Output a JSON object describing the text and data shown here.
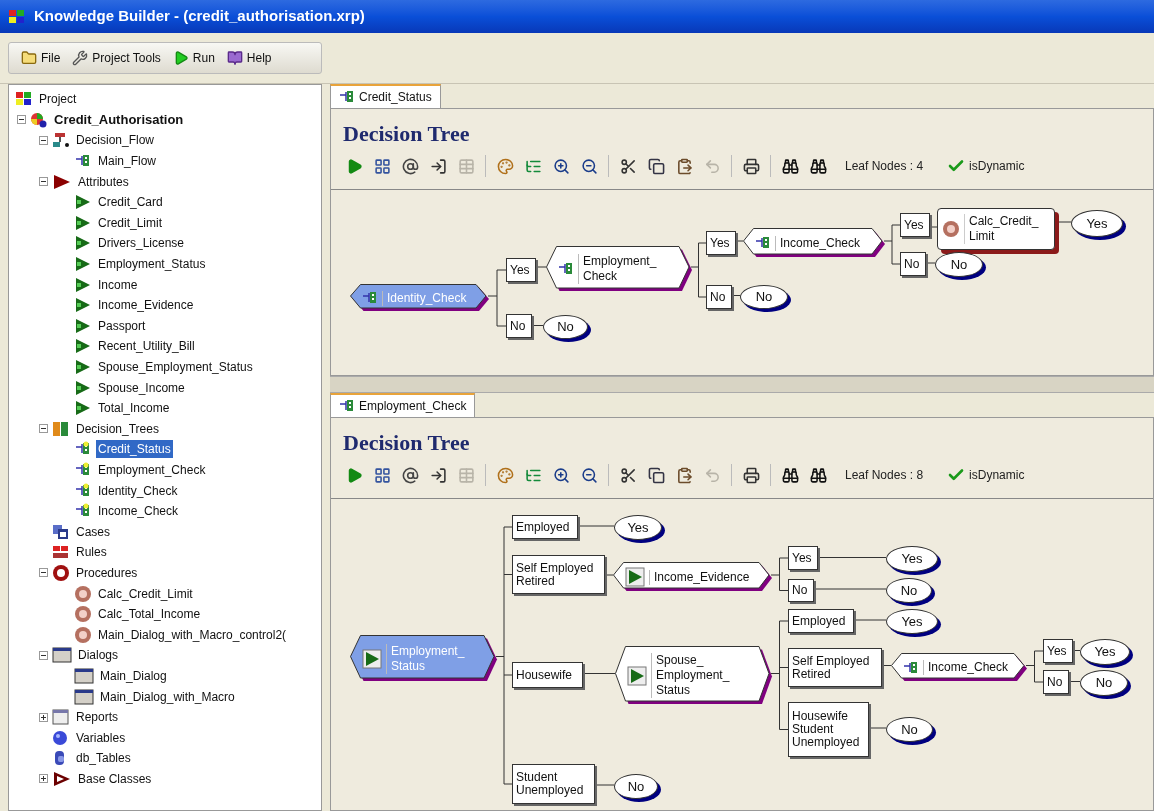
{
  "window": {
    "title": "Knowledge Builder - (credit_authorisation.xrp)"
  },
  "menu": [
    {
      "kind": "file",
      "label": "File"
    },
    {
      "kind": "tools",
      "label": "Project Tools"
    },
    {
      "kind": "run",
      "label": "Run"
    },
    {
      "kind": "help",
      "label": "Help"
    }
  ],
  "project_tree": {
    "label": "Project",
    "kind": "project",
    "children": [
      {
        "label": "Credit_Authorisation",
        "kind": "app",
        "expanded": true,
        "children": [
          {
            "label": "Decision_Flow",
            "kind": "flow",
            "expanded": true,
            "children": [
              {
                "label": "Main_Flow",
                "kind": "flow_item",
                "selected": false
              }
            ]
          },
          {
            "label": "Attributes",
            "kind": "attr_folder",
            "expanded": true,
            "children": [
              {
                "label": "Credit_Card",
                "kind": "attribute",
                "selected": false
              },
              {
                "label": "Credit_Limit",
                "kind": "attribute",
                "selected": false
              },
              {
                "label": "Drivers_License",
                "kind": "attribute",
                "selected": false
              },
              {
                "label": "Employment_Status",
                "kind": "attribute",
                "selected": false
              },
              {
                "label": "Income",
                "kind": "attribute",
                "selected": false
              },
              {
                "label": "Income_Evidence",
                "kind": "attribute",
                "selected": false
              },
              {
                "label": "Passport",
                "kind": "attribute",
                "selected": false
              },
              {
                "label": "Recent_Utility_Bill",
                "kind": "attribute",
                "selected": false
              },
              {
                "label": "Spouse_Employment_Status",
                "kind": "attribute",
                "selected": false
              },
              {
                "label": "Spouse_Income",
                "kind": "attribute",
                "selected": false
              },
              {
                "label": "Total_Income",
                "kind": "attribute",
                "selected": false
              }
            ]
          },
          {
            "label": "Decision_Trees",
            "kind": "tree_folder",
            "expanded": true,
            "children": [
              {
                "label": "Credit_Status",
                "kind": "tree",
                "selected": true
              },
              {
                "label": "Employment_Check",
                "kind": "tree",
                "selected": false
              },
              {
                "label": "Identity_Check",
                "kind": "tree",
                "selected": false
              },
              {
                "label": "Income_Check",
                "kind": "tree",
                "selected": false
              }
            ]
          },
          {
            "label": "Cases",
            "kind": "cases"
          },
          {
            "label": "Rules",
            "kind": "rules"
          },
          {
            "label": "Procedures",
            "kind": "proc_folder",
            "expanded": true,
            "children": [
              {
                "label": "Calc_Credit_Limit",
                "kind": "procedure",
                "selected": false
              },
              {
                "label": "Calc_Total_Income",
                "kind": "procedure",
                "selected": false
              },
              {
                "label": "Main_Dialog_with_Macro_control2(",
                "kind": "procedure",
                "selected": false
              }
            ]
          },
          {
            "label": "Dialogs",
            "kind": "dialog_folder",
            "expanded": true,
            "children": [
              {
                "label": "Main_Dialog",
                "kind": "dialog",
                "selected": false
              },
              {
                "label": "Main_Dialog_with_Macro",
                "kind": "dialog",
                "selected": false
              }
            ]
          },
          {
            "label": "Reports",
            "kind": "reports",
            "expanded": false
          },
          {
            "label": "Variables",
            "kind": "variables"
          },
          {
            "label": "db_Tables",
            "kind": "tables"
          },
          {
            "label": "Base Classes",
            "kind": "classes",
            "expanded": false
          }
        ]
      }
    ]
  },
  "panes": [
    {
      "tab": {
        "label": "Credit_Status",
        "selected": true
      },
      "title": "Decision Tree",
      "leaf_nodes": "Leaf Nodes : 4",
      "dynamic": {
        "label": "isDynamic",
        "checked": true
      },
      "tool_groups": [
        [
          {
            "kind": "run",
            "disabled": false
          },
          {
            "kind": "grid",
            "disabled": false
          },
          {
            "kind": "at",
            "disabled": false
          },
          {
            "kind": "arrow",
            "disabled": false
          },
          {
            "kind": "table",
            "disabled": true
          }
        ],
        [
          {
            "kind": "palette",
            "disabled": false
          },
          {
            "kind": "branch",
            "disabled": false
          },
          {
            "kind": "zoom_in",
            "disabled": false
          },
          {
            "kind": "zoom_out",
            "disabled": false
          }
        ],
        [
          {
            "kind": "cut",
            "disabled": false
          },
          {
            "kind": "copy",
            "disabled": false
          },
          {
            "kind": "paste",
            "disabled": false
          },
          {
            "kind": "undo",
            "disabled": true
          }
        ],
        [
          {
            "kind": "print",
            "disabled": false
          }
        ],
        [
          {
            "kind": "find",
            "disabled": false
          },
          {
            "kind": "find_next",
            "disabled": false
          }
        ]
      ],
      "tree": {
        "kind": "tree_ref",
        "label": "Identity_Check",
        "selected": true,
        "branches": [
          {
            "label": "Yes",
            "node": {
              "kind": "tree_ref",
              "label": "Employment_\nCheck",
              "selected": false,
              "branches": [
                {
                  "label": "Yes",
                  "node": {
                    "kind": "tree_ref",
                    "label": "Income_Check",
                    "selected": false,
                    "branches": [
                      {
                        "label": "Yes",
                        "node": {
                          "kind": "procedure",
                          "label": "Calc_Credit_\nLimit",
                          "selected": false,
                          "next": {
                            "kind": "leaf",
                            "label": "Yes"
                          }
                        }
                      },
                      {
                        "label": "No",
                        "node": {
                          "kind": "leaf",
                          "label": "No"
                        }
                      }
                    ]
                  }
                },
                {
                  "label": "No",
                  "node": {
                    "kind": "leaf",
                    "label": "No"
                  }
                }
              ]
            }
          },
          {
            "label": "No",
            "node": {
              "kind": "leaf",
              "label": "No"
            }
          }
        ]
      }
    },
    {
      "tab": {
        "label": "Employment_Check",
        "selected": true
      },
      "title": "Decision Tree",
      "leaf_nodes": "Leaf Nodes : 8",
      "dynamic": {
        "label": "isDynamic",
        "checked": true
      },
      "tool_groups": [
        [
          {
            "kind": "run",
            "disabled": false
          },
          {
            "kind": "grid",
            "disabled": false
          },
          {
            "kind": "at",
            "disabled": false
          },
          {
            "kind": "arrow",
            "disabled": false
          },
          {
            "kind": "table",
            "disabled": true
          }
        ],
        [
          {
            "kind": "palette",
            "disabled": false
          },
          {
            "kind": "branch",
            "disabled": false
          },
          {
            "kind": "zoom_in",
            "disabled": false
          },
          {
            "kind": "zoom_out",
            "disabled": false
          }
        ],
        [
          {
            "kind": "cut",
            "disabled": false
          },
          {
            "kind": "copy",
            "disabled": false
          },
          {
            "kind": "paste",
            "disabled": false
          },
          {
            "kind": "undo",
            "disabled": true
          }
        ],
        [
          {
            "kind": "print",
            "disabled": false
          }
        ],
        [
          {
            "kind": "find",
            "disabled": false
          },
          {
            "kind": "find_next",
            "disabled": false
          }
        ]
      ],
      "tree": {
        "kind": "attribute",
        "label": "Employment_\nStatus",
        "selected": true,
        "branches": [
          {
            "label": "Employed",
            "node": {
              "kind": "leaf",
              "label": "Yes"
            }
          },
          {
            "label": "Self Employed\nRetired",
            "node": {
              "kind": "attribute",
              "label": "Income_Evidence",
              "selected": false,
              "branches": [
                {
                  "label": "Yes",
                  "node": {
                    "kind": "leaf",
                    "label": "Yes"
                  }
                },
                {
                  "label": "No",
                  "node": {
                    "kind": "leaf",
                    "label": "No"
                  }
                }
              ]
            }
          },
          {
            "label": "Housewife",
            "node": {
              "kind": "attribute",
              "label": "Spouse_\nEmployment_\nStatus",
              "selected": false,
              "branches": [
                {
                  "label": "Employed",
                  "node": {
                    "kind": "leaf",
                    "label": "Yes"
                  }
                },
                {
                  "label": "Self Employed\nRetired",
                  "node": {
                    "kind": "tree_ref",
                    "label": "Income_Check",
                    "selected": false,
                    "branches": [
                      {
                        "label": "Yes",
                        "node": {
                          "kind": "leaf",
                          "label": "Yes"
                        }
                      },
                      {
                        "label": "No",
                        "node": {
                          "kind": "leaf",
                          "label": "No"
                        }
                      }
                    ]
                  }
                },
                {
                  "label": "Housewife\nStudent\nUnemployed",
                  "node": {
                    "kind": "leaf",
                    "label": "No"
                  }
                }
              ]
            }
          },
          {
            "label": "Student\nUnemployed",
            "node": {
              "kind": "leaf",
              "label": "No"
            }
          }
        ]
      }
    }
  ]
}
